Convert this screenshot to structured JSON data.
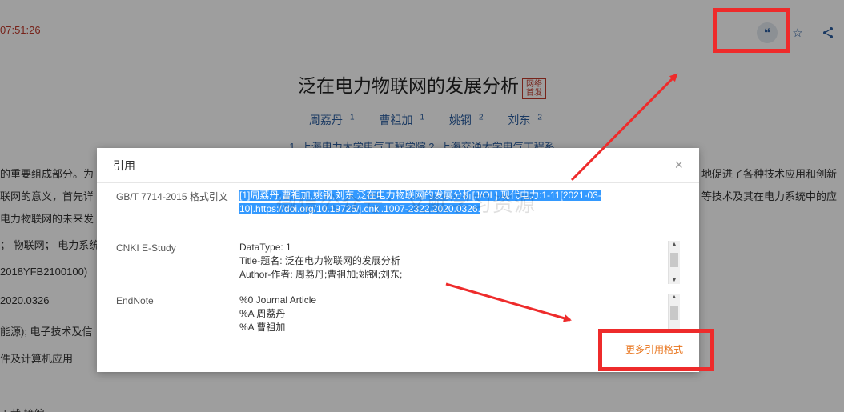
{
  "header": {
    "time_text": "07:51:26"
  },
  "toolbar": {
    "cite_icon": "quote-icon",
    "favorite_icon": "star-icon",
    "share_icon": "share-icon"
  },
  "article": {
    "title": "泛在电力物联网的发展分析",
    "badge": "网络首发",
    "authors": [
      {
        "name": "周荔丹",
        "sup": "1"
      },
      {
        "name": "曹祖加",
        "sup": "1"
      },
      {
        "name": "姚钢",
        "sup": "2"
      },
      {
        "name": "刘东",
        "sup": "2"
      }
    ],
    "affiliation": "1. 上海电力大学电气工程学院  2. 上海交通大学电气工程系",
    "left_fragments": [
      "的重要组成部分。为",
      "联网的意义，首先详",
      "电力物联网的未来发",
      "；  物联网；  电力系统",
      "2018YFB2100100)",
      "2020.0326",
      "能源); 电子技术及信",
      "件及计算机应用",
      "下载  摘编"
    ],
    "right_fragments": [
      "地促进了各种技术应用和创新",
      "等技术及其在电力系统中的应"
    ]
  },
  "modal": {
    "title": "引用",
    "close_label": "×",
    "rows": [
      {
        "label": "GB/T 7714-2015 格式引文",
        "lines": [
          "[1]周荔丹,曹祖加,姚钢,刘东.泛在电力物联网的发展分析[J/OL].现代电力:1-11[2021-03-",
          "10].https://doi.org/10.19725/j.cnki.1007-2322.2020.0326."
        ]
      },
      {
        "label": "CNKI E-Study",
        "lines": [
          "DataType: 1",
          "Title-题名: 泛在电力物联网的发展分析",
          "Author-作者: 周荔丹;曹祖加;姚钢;刘东;"
        ]
      },
      {
        "label": "EndNote",
        "lines": [
          "%0 Journal Article",
          "%A 周荔丹",
          "%A 曹祖加"
        ]
      }
    ],
    "more_formats": "更多引用格式",
    "watermark": "微信公众号：文献学习资源"
  },
  "annotation": {
    "box_color": "#ee2b2b"
  }
}
